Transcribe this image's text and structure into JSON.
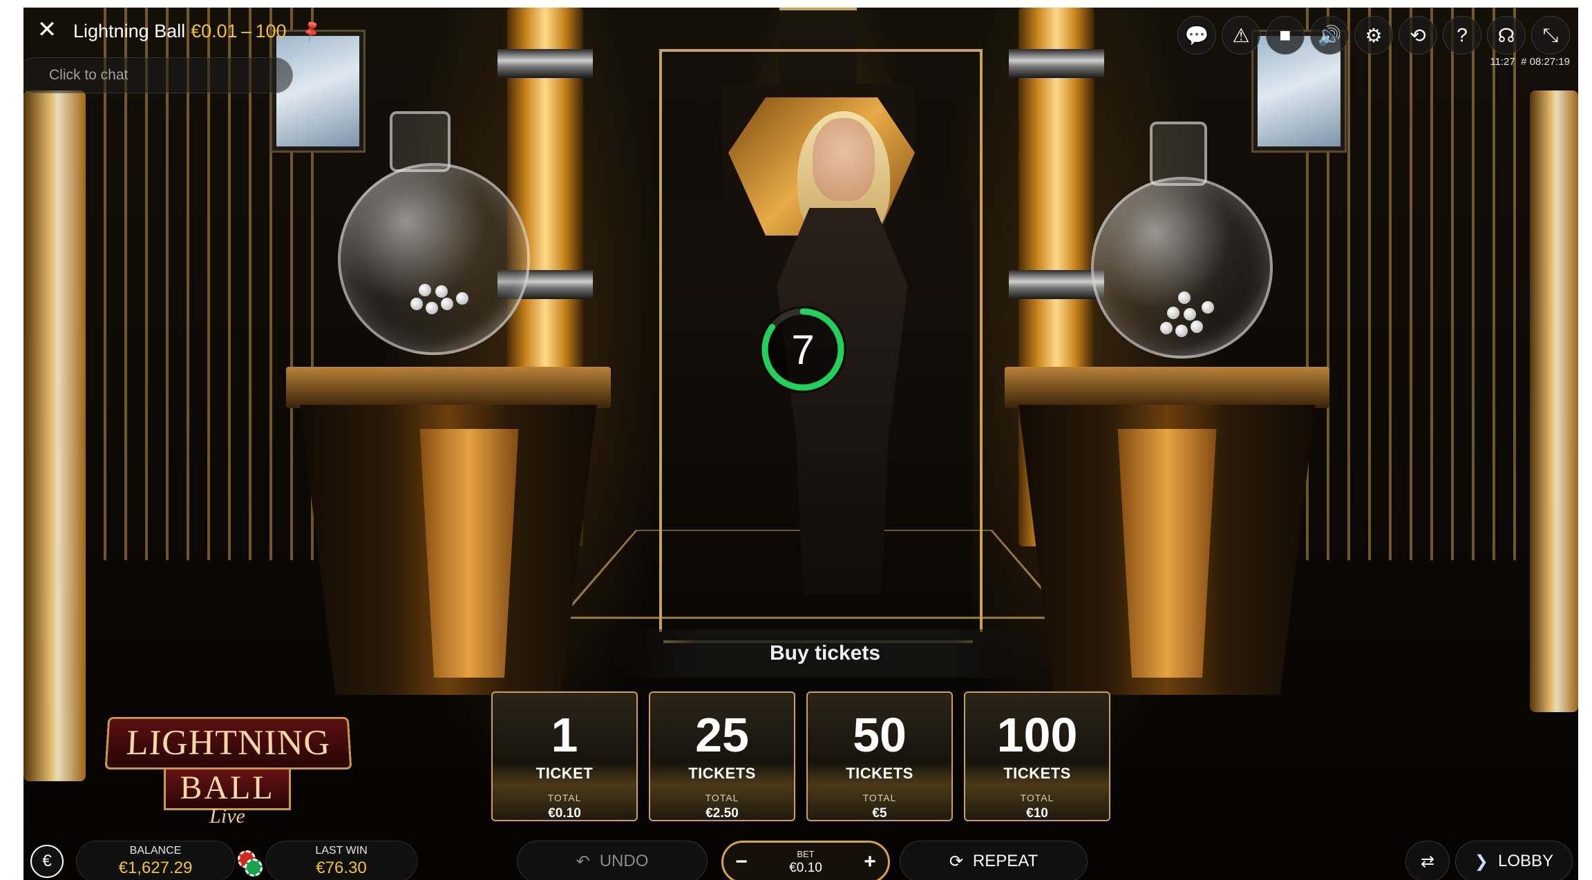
{
  "header": {
    "game_name": "Lightning Ball",
    "limits": "€0.01 – 100",
    "chat_placeholder": "Click to chat",
    "clock": "11:27",
    "round_id": "# 08:27:19"
  },
  "top_icons": [
    {
      "name": "chat-icon",
      "glyph": "💬"
    },
    {
      "name": "warning-icon",
      "glyph": "⚠"
    },
    {
      "name": "video-icon",
      "glyph": "■"
    },
    {
      "name": "sound-icon",
      "glyph": "🔊"
    },
    {
      "name": "settings-icon",
      "glyph": "⚙"
    },
    {
      "name": "history-icon",
      "glyph": "⟲"
    },
    {
      "name": "help-icon",
      "glyph": "?"
    },
    {
      "name": "support-icon",
      "glyph": "☊"
    },
    {
      "name": "exit-fullscreen-icon",
      "glyph": "⤡"
    }
  ],
  "timer": {
    "seconds": "7",
    "progress": 0.85,
    "color": "#1fd35a"
  },
  "buy": {
    "title": "Buy tickets"
  },
  "tickets": [
    {
      "count": "1",
      "unit": "TICKET",
      "total_label": "TOTAL",
      "total": "€0.10"
    },
    {
      "count": "25",
      "unit": "TICKETS",
      "total_label": "TOTAL",
      "total": "€2.50"
    },
    {
      "count": "50",
      "unit": "TICKETS",
      "total_label": "TOTAL",
      "total": "€5"
    },
    {
      "count": "100",
      "unit": "TICKETS",
      "total_label": "TOTAL",
      "total": "€10"
    }
  ],
  "logo": {
    "line1": "LIGHTNING",
    "line2": "BALL",
    "line3": "Live"
  },
  "bottom": {
    "currency_symbol": "€",
    "balance_label": "BALANCE",
    "balance": "€1,627.29",
    "last_win_label": "LAST WIN",
    "last_win": "€76.30",
    "undo_label": "UNDO",
    "bet_label": "BET",
    "bet_value": "€0.10",
    "bet_minus": "−",
    "bet_plus": "+",
    "repeat_label": "REPEAT",
    "lobby_label": "LOBBY"
  },
  "colors": {
    "accent": "#f2c230",
    "gold_border": "#c9a15a",
    "timer_green": "#1fd35a"
  }
}
